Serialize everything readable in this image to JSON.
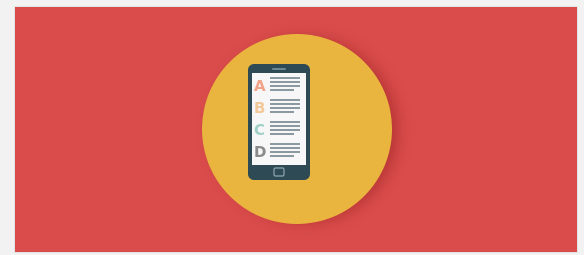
{
  "banner": {
    "background_color": "#d94c4b",
    "circle_color": "#e9b53f",
    "icon": "mobile-quiz-icon"
  },
  "phone": {
    "body_color": "#2e4a55",
    "screen_color": "#f7f7f7",
    "options": [
      {
        "letter": "A",
        "color": "#f2a387"
      },
      {
        "letter": "B",
        "color": "#f3c89b"
      },
      {
        "letter": "C",
        "color": "#9fd0c6"
      },
      {
        "letter": "D",
        "color": "#8a8a8a"
      }
    ]
  }
}
